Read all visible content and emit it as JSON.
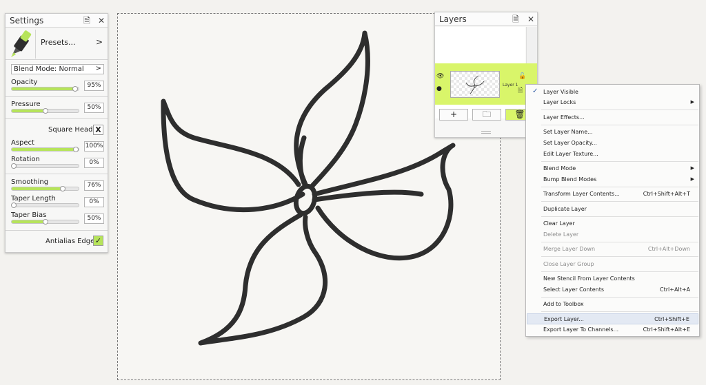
{
  "settings": {
    "title": "Settings",
    "presets_label": "Presets...",
    "presets_arrow": ">",
    "blend_mode_label": "Blend Mode: Normal",
    "blend_mode_arrow": ">",
    "opacity": {
      "label": "Opacity",
      "value": "95%",
      "fraction": 0.95
    },
    "pressure": {
      "label": "Pressure",
      "value": "50%",
      "fraction": 0.5
    },
    "square_head": {
      "label": "Square Head",
      "mark": "X"
    },
    "aspect": {
      "label": "Aspect",
      "value": "100%",
      "fraction": 1.0
    },
    "rotation": {
      "label": "Rotation",
      "value": "0%",
      "fraction": 0.0
    },
    "smoothing": {
      "label": "Smoothing",
      "value": "76%",
      "fraction": 0.76
    },
    "taper_length": {
      "label": "Taper Length",
      "value": "0%",
      "fraction": 0.0
    },
    "taper_bias": {
      "label": "Taper Bias",
      "value": "50%",
      "fraction": 0.5
    },
    "antialias": {
      "label": "Antialias Edge",
      "mark": "✓"
    }
  },
  "layers": {
    "title": "Layers",
    "layer_name": "Layer 1",
    "add_btn": "+",
    "folder_btn": "🗀",
    "delete_btn": "🗑"
  },
  "header_icons": {
    "menu": "🗎",
    "close": "✕"
  },
  "context_menu": {
    "items": [
      {
        "label": "Layer Visible",
        "checked": true
      },
      {
        "label": "Layer Locks",
        "submenu": true
      },
      {
        "label": "Layer Effects..."
      },
      {
        "label": "Set Layer Name..."
      },
      {
        "label": "Set Layer Opacity..."
      },
      {
        "label": "Edit Layer Texture..."
      },
      {
        "label": "Blend Mode",
        "submenu": true
      },
      {
        "label": "Bump Blend Modes",
        "submenu": true
      },
      {
        "label": "Transform Layer Contents...",
        "shortcut": "Ctrl+Shift+Alt+T"
      },
      {
        "label": "Duplicate Layer"
      },
      {
        "label": "Clear Layer"
      },
      {
        "label": "Delete Layer",
        "disabled": true
      },
      {
        "label": "Merge Layer Down",
        "shortcut": "Ctrl+Alt+Down",
        "disabled": true
      },
      {
        "label": "Close Layer Group",
        "disabled": true
      },
      {
        "label": "New Stencil From Layer Contents"
      },
      {
        "label": "Select Layer Contents",
        "shortcut": "Ctrl+Alt+A"
      },
      {
        "label": "Add to Toolbox"
      },
      {
        "label": "Export Layer...",
        "shortcut": "Ctrl+Shift+E",
        "highlighted": true
      },
      {
        "label": "Export Layer To Channels...",
        "shortcut": "Ctrl+Shift+Alt+E"
      }
    ],
    "check_glyph": "✓",
    "submenu_glyph": "▶"
  },
  "colors": {
    "accent_green": "#b6e45a",
    "layer_highlight": "#d9f56a",
    "stroke": "#2e2e2e"
  }
}
